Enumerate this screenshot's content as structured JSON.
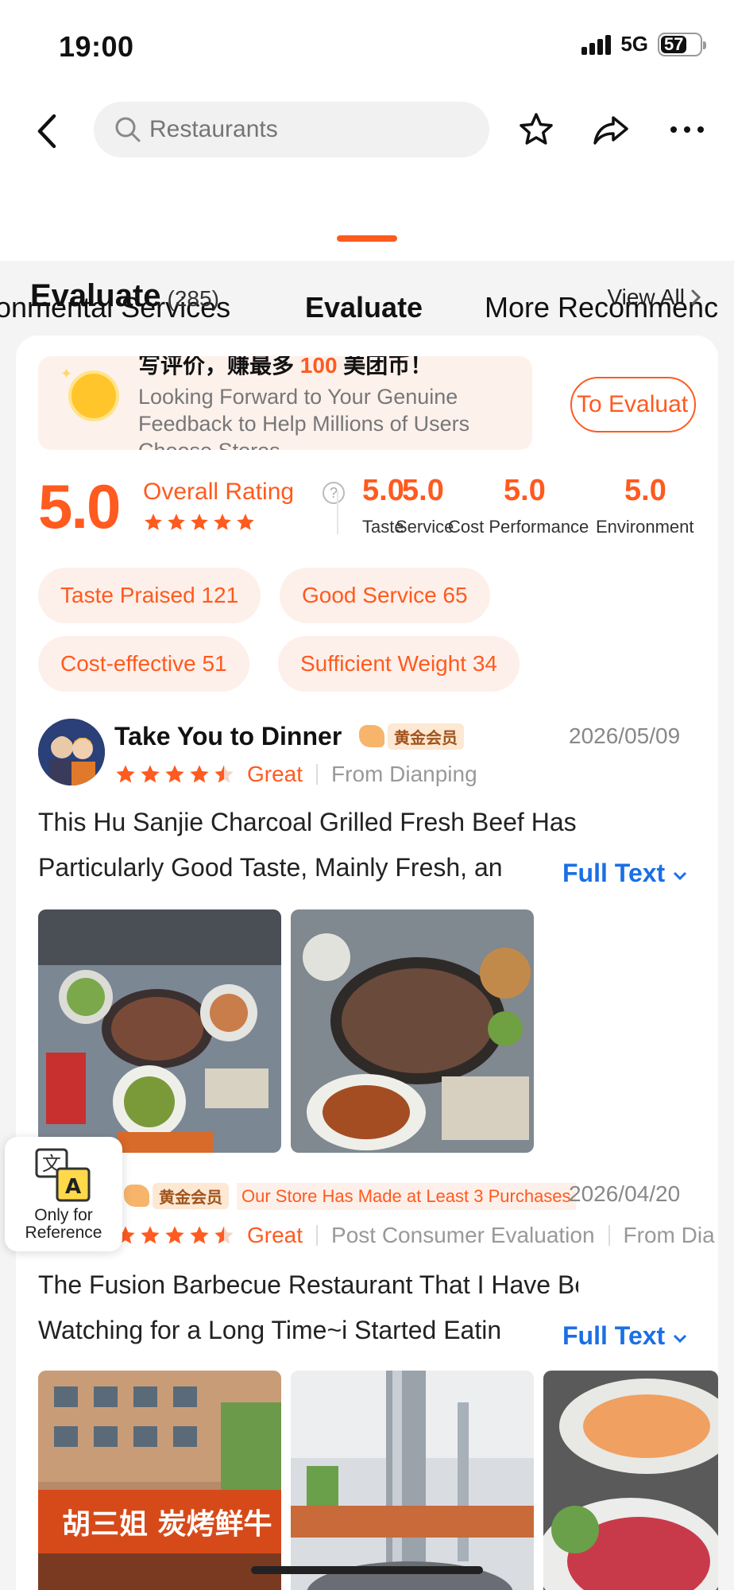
{
  "status_bar": {
    "time": "19:00",
    "network": "5G",
    "battery": "57"
  },
  "header": {
    "search_placeholder": "Restaurants",
    "tabs": [
      {
        "label": "onmental Services",
        "active": false
      },
      {
        "label": "Evaluate",
        "active": true
      },
      {
        "label": "More Recommenc",
        "active": false
      }
    ]
  },
  "section": {
    "title": "Evaluate",
    "count": "(285)",
    "view_all": "View All"
  },
  "promo": {
    "headline_a": "写评价，赚最多",
    "headline_num": "100",
    "headline_b": "美团币！",
    "subtitle": "Looking Forward to Your Genuine Feedback to Help Millions of Users Choose Stores",
    "button": "To Evaluat"
  },
  "rating": {
    "overall": "5.0",
    "overall_label": "Overall Rating",
    "help": "?",
    "stars": 5,
    "sub_scores": [
      {
        "value": "5.0",
        "label": "Taste"
      },
      {
        "value": "5.0",
        "label": "Service"
      },
      {
        "value": "5.0",
        "label": "Cost Performance"
      },
      {
        "value": "5.0",
        "label": "Environment"
      }
    ]
  },
  "tags": [
    "Taste Praised 121",
    "Good Service 65",
    "Cost-effective 51",
    "Sufficient Weight 34"
  ],
  "reviews": [
    {
      "user": "Take You to Dinner",
      "badge": "黄金会员",
      "date": "2026/05/09",
      "stars": 4.5,
      "verdict": "Great",
      "source": "From Dianping",
      "text_line1": "This Hu Sanjie Charcoal Grilled Fresh Beef Has a",
      "text_line2": "Particularly Good Taste, Mainly Fresh, an",
      "full_text": "Full Text"
    },
    {
      "badge": "黄金会员",
      "store_tag": "Our Store Has Made at Least 3 Purchases",
      "date": "2026/04/20",
      "stars": 4.5,
      "verdict": "Great",
      "post_type": "Post Consumer Evaluation",
      "source": "From Dia",
      "text_line1": "The Fusion Barbecue Restaurant That I Have Been",
      "text_line2": "Watching for a Long Time~i Started Eatin",
      "full_text": "Full Text",
      "photo_sign": "胡三姐 炭烤鲜牛"
    }
  ],
  "translate": {
    "glyph_zh": "文",
    "glyph_en": "A",
    "label": "Only for Reference"
  },
  "colors": {
    "accent": "#ff5a1f",
    "link": "#1a6fe5",
    "tag_bg": "#fdf0ea"
  }
}
